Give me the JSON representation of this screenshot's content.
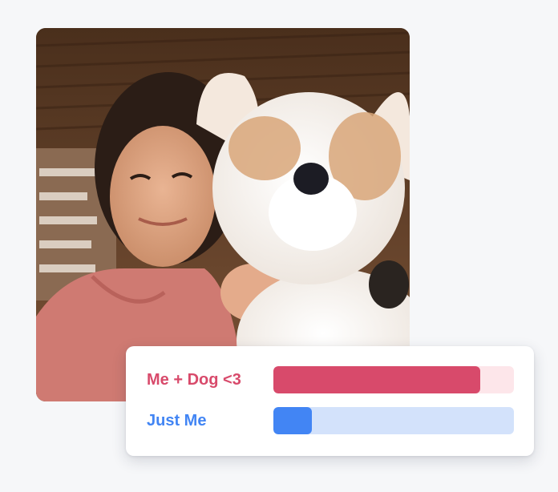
{
  "photo": {
    "subject": "selfie-with-plush-dog"
  },
  "poll": {
    "options": [
      {
        "label": "Me + Dog <3",
        "fill_fraction": 0.86,
        "label_color": "#d84a6b",
        "fill_color": "#d84a6b",
        "track_color": "#fde6ea"
      },
      {
        "label": "Just Me",
        "fill_fraction": 0.16,
        "label_color": "#4285f4",
        "fill_color": "#4285f4",
        "track_color": "#d3e2fb"
      }
    ]
  }
}
